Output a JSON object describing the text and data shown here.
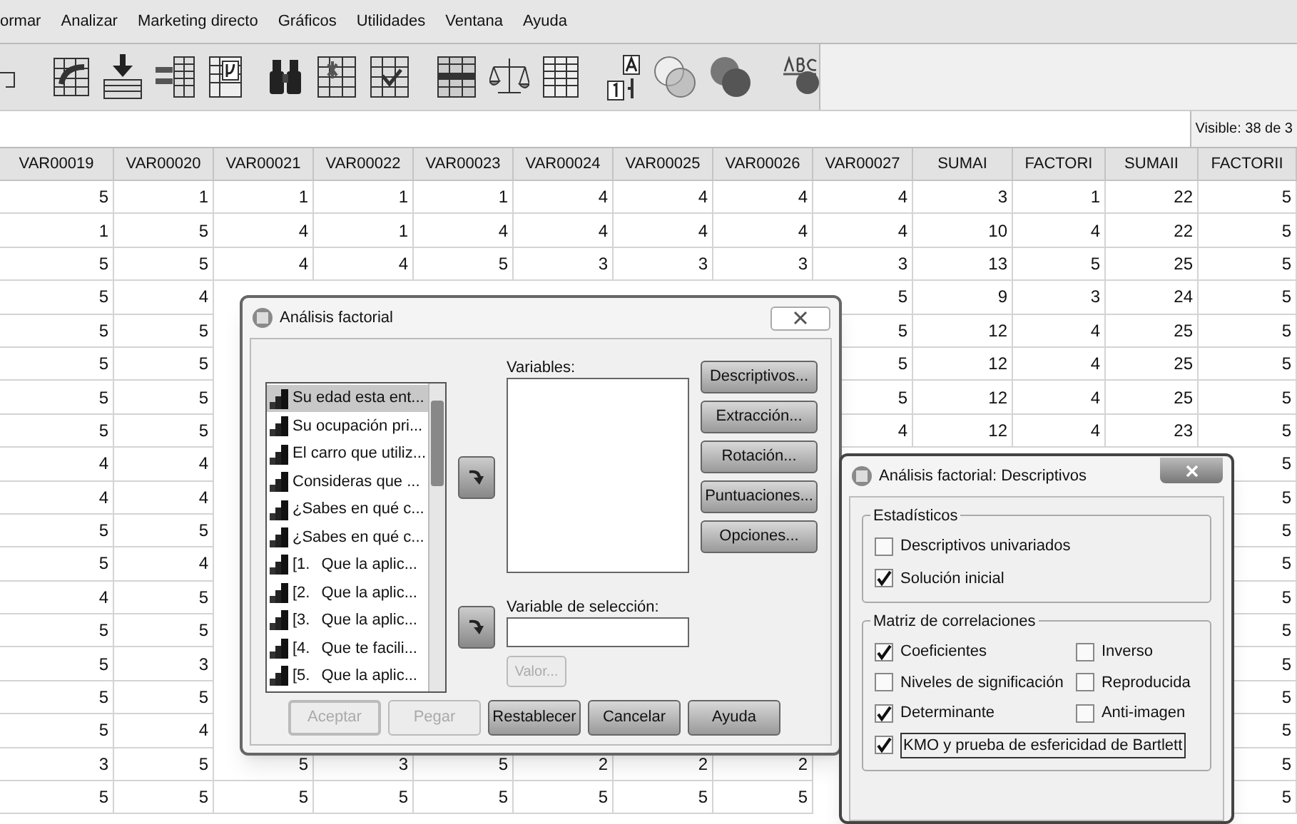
{
  "menu": [
    "ormar",
    "Analizar",
    "Marketing directo",
    "Gráficos",
    "Utilidades",
    "Ventana",
    "Ayuda"
  ],
  "status": {
    "text": "Visible: 38 de 3"
  },
  "table": {
    "columns": [
      "VAR00019",
      "VAR00020",
      "VAR00021",
      "VAR00022",
      "VAR00023",
      "VAR00024",
      "VAR00025",
      "VAR00026",
      "VAR00027",
      "SUMAI",
      "FACTORI",
      "SUMAII",
      "FACTORII"
    ],
    "rows": [
      [
        "5",
        "1",
        "1",
        "1",
        "1",
        "4",
        "4",
        "4",
        "4",
        "3",
        "1",
        "22",
        "5"
      ],
      [
        "1",
        "5",
        "4",
        "1",
        "4",
        "4",
        "4",
        "4",
        "4",
        "10",
        "4",
        "22",
        "5"
      ],
      [
        "5",
        "5",
        "4",
        "4",
        "5",
        "3",
        "3",
        "3",
        "3",
        "13",
        "5",
        "25",
        "5"
      ],
      [
        "5",
        "4",
        null,
        null,
        null,
        null,
        null,
        null,
        "5",
        "9",
        "3",
        "24",
        "5"
      ],
      [
        "5",
        "5",
        null,
        null,
        null,
        null,
        null,
        null,
        "5",
        "12",
        "4",
        "25",
        "5"
      ],
      [
        "5",
        "5",
        null,
        null,
        null,
        null,
        null,
        null,
        "5",
        "12",
        "4",
        "25",
        "5"
      ],
      [
        "5",
        "5",
        null,
        null,
        null,
        null,
        null,
        null,
        "5",
        "12",
        "4",
        "25",
        "5"
      ],
      [
        "5",
        "5",
        null,
        null,
        null,
        null,
        null,
        null,
        "4",
        "12",
        "4",
        "23",
        "5"
      ],
      [
        "4",
        "4",
        null,
        null,
        null,
        null,
        null,
        null,
        null,
        null,
        null,
        null,
        "5"
      ],
      [
        "4",
        "4",
        null,
        null,
        null,
        null,
        null,
        null,
        null,
        null,
        null,
        null,
        "5"
      ],
      [
        "5",
        "5",
        null,
        null,
        null,
        null,
        null,
        null,
        null,
        null,
        null,
        null,
        "5"
      ],
      [
        "5",
        "4",
        null,
        null,
        null,
        null,
        null,
        null,
        null,
        null,
        null,
        null,
        "5"
      ],
      [
        "4",
        "5",
        null,
        null,
        null,
        null,
        null,
        null,
        null,
        null,
        null,
        null,
        "5"
      ],
      [
        "5",
        "5",
        null,
        null,
        null,
        null,
        null,
        null,
        null,
        null,
        null,
        null,
        "5"
      ],
      [
        "5",
        "3",
        null,
        null,
        null,
        null,
        null,
        null,
        null,
        null,
        null,
        null,
        "5"
      ],
      [
        "5",
        "5",
        null,
        null,
        null,
        null,
        null,
        null,
        null,
        null,
        null,
        null,
        "5"
      ],
      [
        "5",
        "4",
        null,
        null,
        null,
        null,
        null,
        null,
        null,
        null,
        null,
        null,
        "5"
      ],
      [
        "3",
        "5",
        "5",
        "3",
        "5",
        "2",
        "2",
        "2",
        null,
        null,
        null,
        null,
        "5"
      ],
      [
        "5",
        "5",
        "5",
        "5",
        "5",
        "5",
        "5",
        "5",
        null,
        null,
        null,
        null,
        "5"
      ]
    ]
  },
  "dialog": {
    "title": "Análisis factorial",
    "source_list": [
      {
        "label": "Su edad esta ent...",
        "selected": true
      },
      {
        "label": "Su ocupación pri...",
        "selected": false
      },
      {
        "label": "El carro que utiliz...",
        "selected": false
      },
      {
        "label": "Consideras que ...",
        "selected": false
      },
      {
        "label": "¿Sabes en qué c...",
        "selected": false
      },
      {
        "label": "¿Sabes en qué c...",
        "selected": false
      },
      {
        "prefix": "[1.",
        "label": "Que la aplic...",
        "selected": false
      },
      {
        "prefix": "[2.",
        "label": "Que la aplic...",
        "selected": false
      },
      {
        "prefix": "[3.",
        "label": "Que la aplic...",
        "selected": false
      },
      {
        "prefix": "[4.",
        "label": "Que te facili...",
        "selected": false
      },
      {
        "prefix": "[5.",
        "label": "Que la aplic...",
        "selected": false
      }
    ],
    "variables_label": "Variables:",
    "selection_label": "Variable de selección:",
    "value_button": {
      "label": "Valor...",
      "disabled": true
    },
    "side_buttons": [
      "Descriptivos...",
      "Extracción...",
      "Rotación...",
      "Puntuaciones...",
      "Opciones..."
    ],
    "buttons": [
      {
        "label": "Aceptar",
        "disabled": true
      },
      {
        "label": "Pegar",
        "disabled": true
      },
      {
        "label": "Restablecer",
        "disabled": false
      },
      {
        "label": "Cancelar",
        "disabled": false
      },
      {
        "label": "Ayuda",
        "disabled": false
      }
    ]
  },
  "descriptives_dialog": {
    "title": "Análisis factorial: Descriptivos",
    "groups": [
      {
        "title": "Estadísticos",
        "options": [
          {
            "label": "Descriptivos univariados",
            "checked": false
          },
          {
            "label": "Solución inicial",
            "checked": true
          }
        ]
      },
      {
        "title": "Matriz de correlaciones",
        "options": [
          {
            "label": "Coeficientes",
            "checked": true,
            "focused": false
          },
          {
            "label": "Inverso",
            "checked": false,
            "focused": false
          },
          {
            "label": "Niveles de significación",
            "checked": false,
            "focused": false
          },
          {
            "label": "Reproducida",
            "checked": false,
            "focused": false
          },
          {
            "label": "Determinante",
            "checked": true,
            "focused": false
          },
          {
            "label": "Anti-imagen",
            "checked": false,
            "focused": false
          },
          {
            "label": "KMO y prueba de esfericidad de Bartlett",
            "checked": true,
            "focused": true
          }
        ]
      }
    ]
  }
}
